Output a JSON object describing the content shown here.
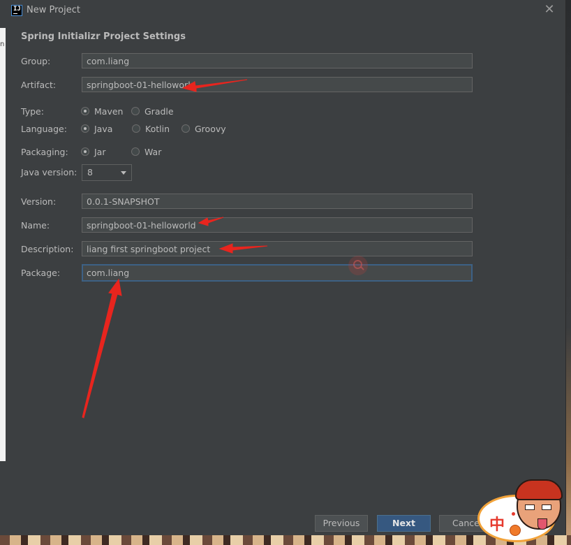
{
  "window": {
    "title": "New Project",
    "icon": "intellij-icon",
    "close": "close-icon"
  },
  "section_title": "Spring Initializr Project Settings",
  "fields": {
    "group": {
      "label": "Group:",
      "value": "com.liang"
    },
    "artifact": {
      "label": "Artifact:",
      "value": "springboot-01-helloworld"
    },
    "version": {
      "label": "Version:",
      "value": "0.0.1-SNAPSHOT"
    },
    "name": {
      "label": "Name:",
      "value": "springboot-01-helloworld"
    },
    "description": {
      "label": "Description:",
      "value": "liang first springboot project"
    },
    "package": {
      "label": "Package:",
      "value": "com.liang"
    }
  },
  "type": {
    "label": "Type:",
    "options": [
      "Maven",
      "Gradle"
    ],
    "selected": "Maven"
  },
  "language": {
    "label": "Language:",
    "options": [
      "Java",
      "Kotlin",
      "Groovy"
    ],
    "selected": "Java"
  },
  "packaging": {
    "label": "Packaging:",
    "options": [
      "Jar",
      "War"
    ],
    "selected": "Jar"
  },
  "java_version": {
    "label": "Java version:",
    "value": "8"
  },
  "buttons": {
    "previous": "Previous",
    "next": "Next",
    "cancel": "Cance"
  },
  "background_text": "n",
  "ime_badge": {
    "char": "中"
  },
  "colors": {
    "annotation_arrow": "#e8251e",
    "primary_button": "#365880",
    "focus_border": "#3d6185"
  }
}
